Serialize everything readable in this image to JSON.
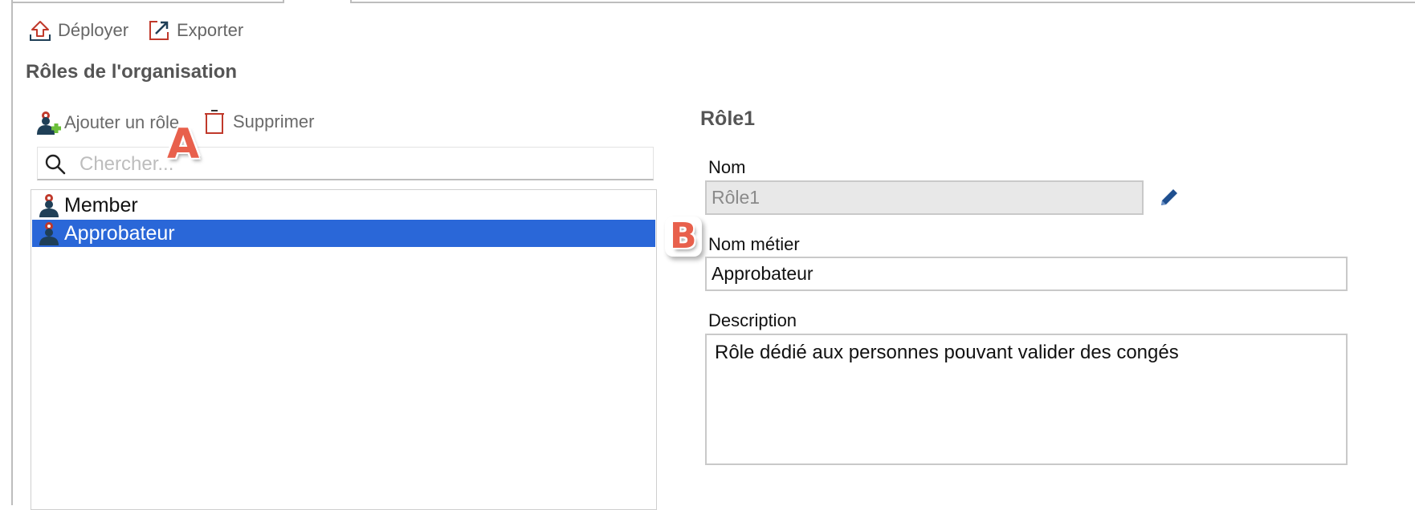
{
  "toolbar": {
    "deploy_label": "Déployer",
    "export_label": "Exporter"
  },
  "section_title": "Rôles de l'organisation",
  "roles_toolbar": {
    "add_label": "Ajouter un rôle",
    "delete_label": "Supprimer"
  },
  "search": {
    "placeholder": "Chercher...",
    "value": ""
  },
  "roles": [
    {
      "label": "Member",
      "selected": false
    },
    {
      "label": "Approbateur",
      "selected": true
    }
  ],
  "callouts": {
    "a": "A",
    "b": "B"
  },
  "detail": {
    "title": "Rôle1",
    "name_label": "Nom",
    "name_value": "Rôle1",
    "business_name_label": "Nom métier",
    "business_name_value": "Approbateur",
    "description_label": "Description",
    "description_value": "Rôle dédié aux personnes pouvant valider des congés"
  },
  "colors": {
    "selection": "#2a67d8",
    "icon_red": "#c0392b",
    "callout": "#e8604c",
    "user_icon": "#1f3f57"
  },
  "icons": [
    "deploy-icon",
    "export-icon",
    "add-role-icon",
    "trash-icon",
    "search-icon",
    "role-user-icon",
    "pencil-icon"
  ]
}
